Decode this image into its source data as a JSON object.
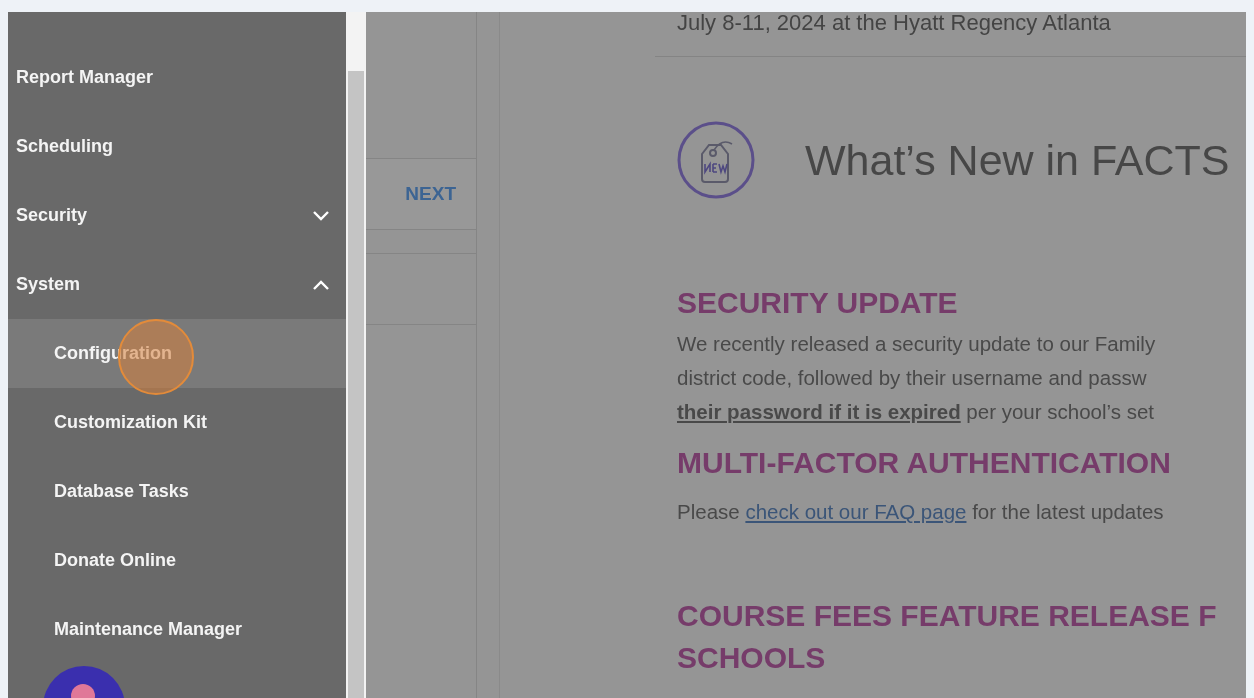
{
  "sidebar": {
    "items": [
      {
        "label": "Report Manager",
        "kind": "link",
        "selected": false
      },
      {
        "label": "Scheduling",
        "kind": "link",
        "selected": false
      },
      {
        "label": "Security",
        "kind": "group",
        "expanded": false,
        "selected": false
      },
      {
        "label": "System",
        "kind": "group",
        "expanded": true,
        "selected": false,
        "children": [
          {
            "label": "Configuration",
            "kind": "link",
            "selected": true
          },
          {
            "label": "Customization Kit",
            "kind": "link",
            "selected": false
          },
          {
            "label": "Database Tasks",
            "kind": "link",
            "selected": false
          },
          {
            "label": "Donate Online",
            "kind": "link",
            "selected": false
          },
          {
            "label": "Maintenance Manager",
            "kind": "link",
            "selected": false
          }
        ]
      }
    ]
  },
  "pager": {
    "next_button": "NEXT"
  },
  "article": {
    "event_line": "July 8-11, 2024 at the Hyatt Regency Atlanta",
    "title": "What’s New in FACTS",
    "sections": [
      {
        "kind": "text",
        "heading": [
          "SECURITY UPDATE"
        ],
        "lines": [
          "We recently released a security update to our Family",
          "district code, followed by their username and passw",
          "**their password if it is expired** per your school’s set"
        ]
      },
      {
        "kind": "link",
        "heading": [
          "MULTI-FACTOR AUTHENTICATION"
        ],
        "before": "Please ",
        "link": "check out our FAQ page",
        "after": " for the latest updates"
      },
      {
        "kind": "heading",
        "heading": [
          "COURSE FEES FEATURE RELEASE F",
          "SCHOOLS"
        ]
      }
    ]
  }
}
